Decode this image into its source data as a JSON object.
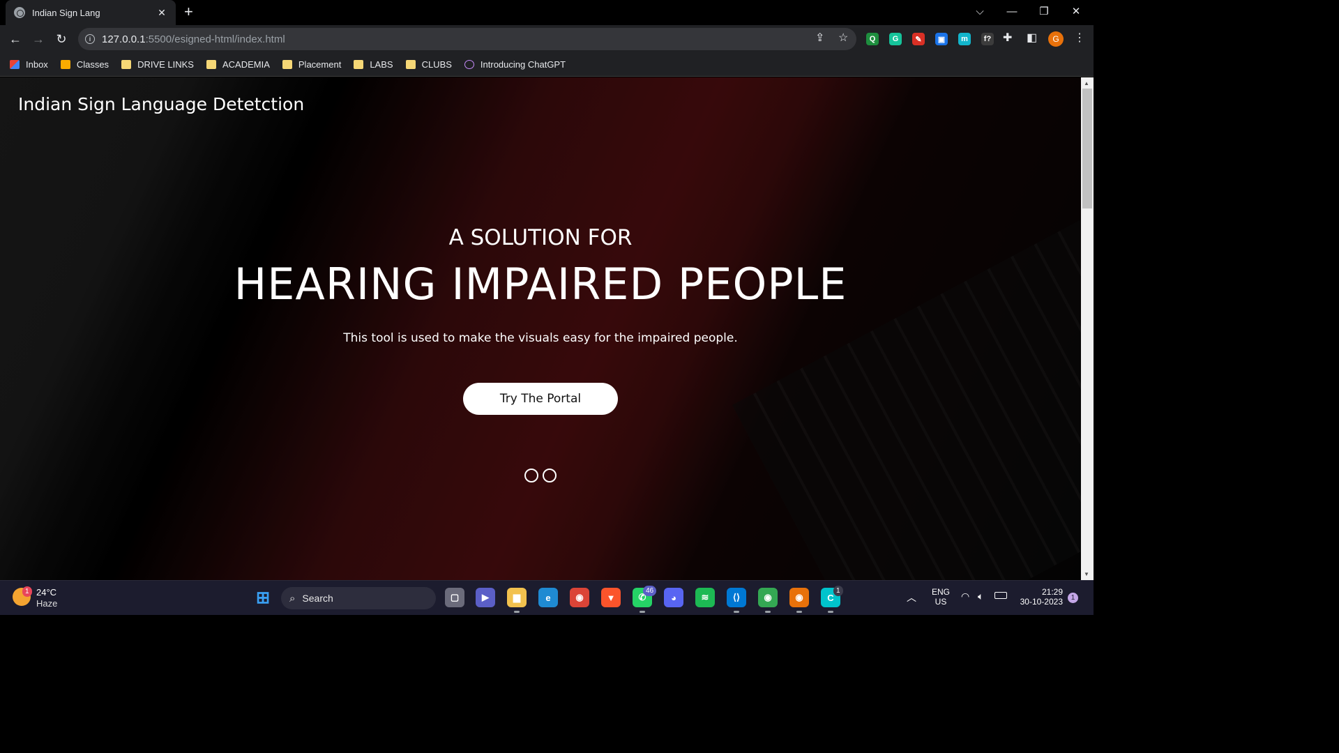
{
  "browser": {
    "tab_title": "Indian Sign Lang",
    "url_host": "127.0.0.1",
    "url_path": ":5500/esigned-html/index.html",
    "extensions": [
      {
        "name": "q-extension-icon",
        "glyph": "Q",
        "color": "#1e8e3e"
      },
      {
        "name": "grammarly-icon",
        "glyph": "G",
        "color": "#15c39a"
      },
      {
        "name": "pen-extension-icon",
        "glyph": "✎",
        "color": "#d93025"
      },
      {
        "name": "screenshot-extension-icon",
        "glyph": "▣",
        "color": "#1a73e8"
      },
      {
        "name": "m-extension-icon",
        "glyph": "m",
        "color": "#12b5cb"
      },
      {
        "name": "formula-extension-icon",
        "glyph": "f?",
        "color": "#3c3c3c"
      }
    ],
    "profile_initial": "G"
  },
  "bookmarks": [
    {
      "label": "Inbox",
      "type": "gmail"
    },
    {
      "label": "Classes",
      "type": "classroom"
    },
    {
      "label": "DRIVE LINKS",
      "type": "folder"
    },
    {
      "label": "ACADEMIA",
      "type": "folder"
    },
    {
      "label": "Placement",
      "type": "folder"
    },
    {
      "label": "LABS",
      "type": "folder"
    },
    {
      "label": "CLUBS",
      "type": "folder"
    },
    {
      "label": "Introducing ChatGPT",
      "type": "chatgpt"
    }
  ],
  "hero": {
    "brand": "Indian Sign Language Detetction",
    "subtitle": "A SOLUTION FOR",
    "headline": "HEARING IMPAIRED PEOPLE",
    "description": "This tool is used to make the visuals easy for the impaired people.",
    "cta_label": "Try The Portal",
    "slider_dots": 2
  },
  "taskbar": {
    "weather_temp": "24°C",
    "weather_desc": "Haze",
    "weather_badge": "1",
    "search_label": "Search",
    "whatsapp_badge": "46",
    "canva_badge": "1",
    "lang_top": "ENG",
    "lang_bottom": "US",
    "time": "21:29",
    "date": "30-10-2023",
    "notification_count": "1"
  }
}
